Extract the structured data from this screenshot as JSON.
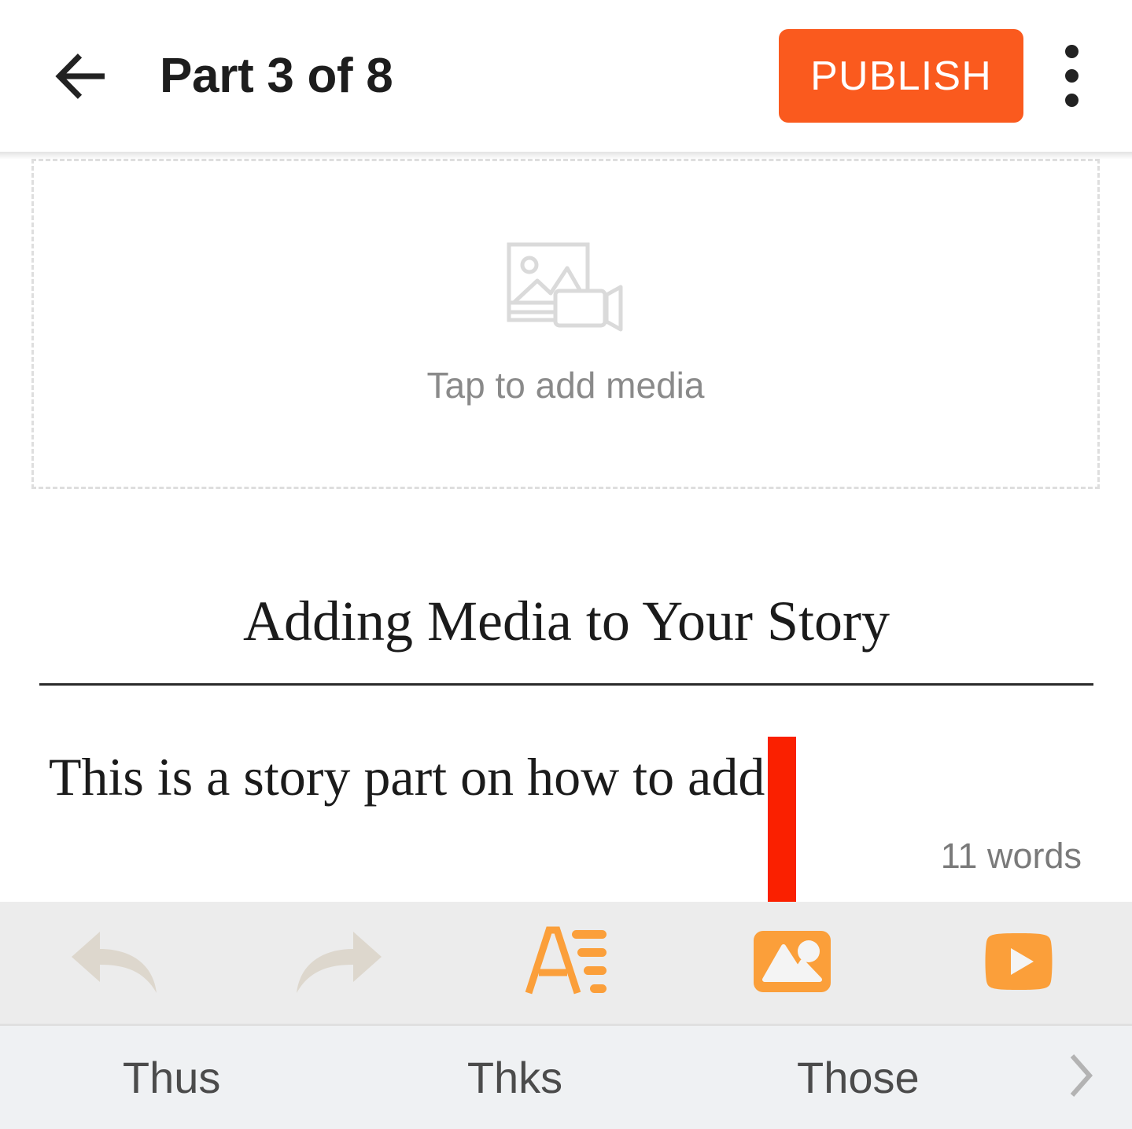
{
  "appbar": {
    "back_icon": "back-arrow-icon",
    "title": "Part 3 of 8",
    "publish_label": "PUBLISH",
    "overflow_icon": "kebab-menu-icon",
    "publish_color": "#fa5a1e"
  },
  "editor": {
    "media_placeholder": {
      "icon": "image-video-placeholder-icon",
      "label": "Tap to add media"
    },
    "story_title": "Adding Media to Your Story",
    "story_body": "This is a story part on how to add",
    "word_count": "11 words"
  },
  "annotation": {
    "shape": "down-arrow",
    "color": "#fa2000",
    "points_to": "insert-image-tool"
  },
  "toolbar": {
    "items": [
      {
        "name": "undo-icon",
        "label": "Undo",
        "state": "disabled",
        "color": "#ddd7cd"
      },
      {
        "name": "redo-icon",
        "label": "Redo",
        "state": "disabled",
        "color": "#ddd7cd"
      },
      {
        "name": "text-format-icon",
        "label": "Text formatting",
        "state": "enabled",
        "color": "#fb9f3a"
      },
      {
        "name": "insert-image-icon",
        "label": "Insert image",
        "state": "enabled",
        "color": "#fb9f3a"
      },
      {
        "name": "insert-video-icon",
        "label": "Insert video",
        "state": "enabled",
        "color": "#fb9f3a"
      }
    ]
  },
  "keyboard": {
    "suggestions": [
      "Thus",
      "Thks",
      "Those"
    ],
    "next_icon": "chevron-right-icon"
  }
}
